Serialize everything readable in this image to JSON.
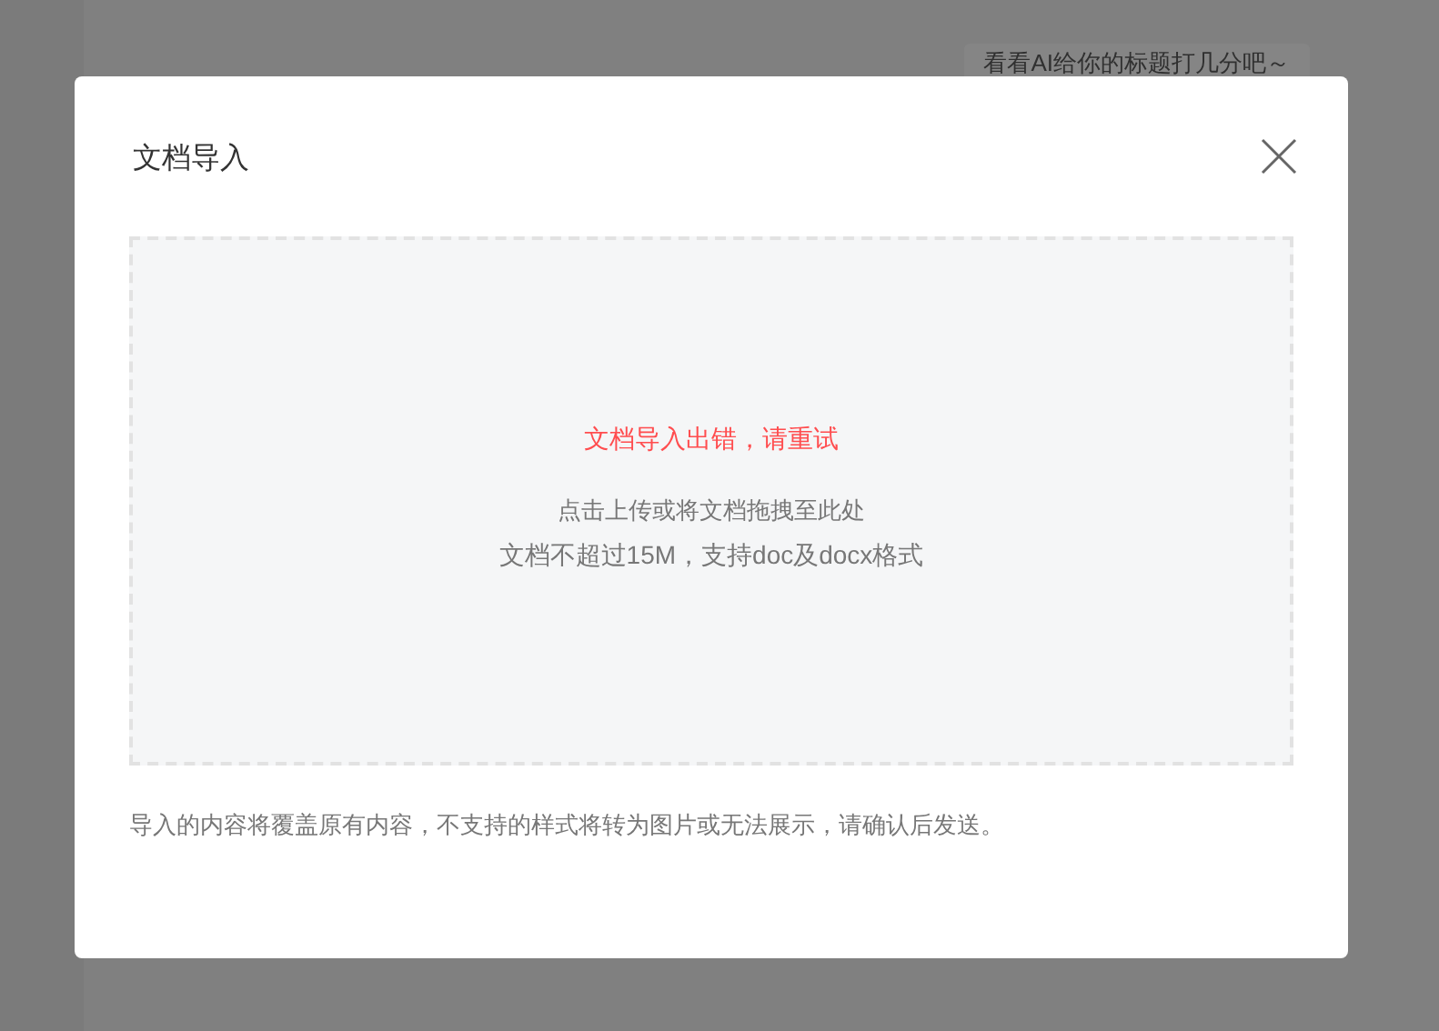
{
  "background": {
    "hint_button": "看看AI给你的标题打几分吧～"
  },
  "dialog": {
    "title": "文档导入",
    "upload_area": {
      "error": "文档导入出错，请重试",
      "instruction": "点击上传或将文档拖拽至此处",
      "limits": "文档不超过15M，支持doc及docx格式"
    },
    "notice": "导入的内容将覆盖原有内容，不支持的样式将转为图片或无法展示，请确认后发送。"
  }
}
